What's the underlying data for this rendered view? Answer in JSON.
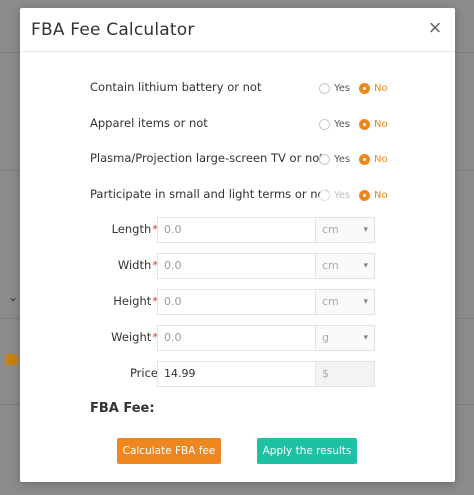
{
  "modal": {
    "title": "FBA Fee Calculator",
    "close_glyph": "×"
  },
  "questions": [
    {
      "label": "Contain lithium battery or not",
      "yes": "Yes",
      "no": "No",
      "selected": "no"
    },
    {
      "label": "Apparel items or not",
      "yes": "Yes",
      "no": "No",
      "selected": "no"
    },
    {
      "label": "Plasma/Projection large-screen TV or not",
      "yes": "Yes",
      "no": "No",
      "selected": "no"
    },
    {
      "label": "Participate in small and light terms or not",
      "yes": "Yes",
      "no": "No",
      "selected": "no",
      "yes_disabled": true
    }
  ],
  "fields": [
    {
      "label": "Length",
      "required": "*",
      "value": "0.0",
      "unit": "cm"
    },
    {
      "label": "Width",
      "required": "*",
      "value": "0.0",
      "unit": "cm"
    },
    {
      "label": "Height",
      "required": "*",
      "value": "0.0",
      "unit": "cm"
    },
    {
      "label": "Weight",
      "required": "*",
      "value": "0.0",
      "unit": "g"
    },
    {
      "label": "Price",
      "value": "14.99",
      "unit": "$"
    }
  ],
  "result": {
    "fee_label": "FBA Fee:"
  },
  "buttons": {
    "calculate": "Calculate FBA fee",
    "apply": "Apply the results"
  },
  "colors": {
    "accent_orange": "#f0861e",
    "accent_teal": "#1fc1a3",
    "required_red": "#e03c3c"
  }
}
